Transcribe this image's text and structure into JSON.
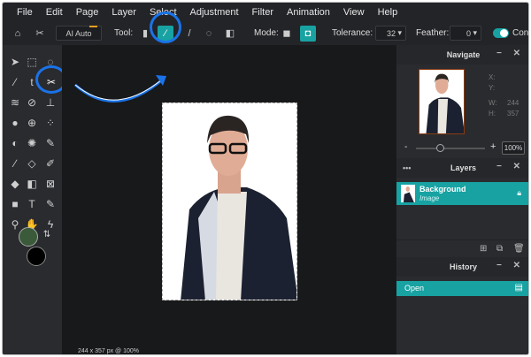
{
  "menu": [
    "File",
    "Edit",
    "Page",
    "Layer",
    "Select",
    "Adjustment",
    "Filter",
    "Animation",
    "View",
    "Help"
  ],
  "toolbar": {
    "ai_auto": "AI Auto",
    "tool_label": "Tool:",
    "mode_label": "Mode:",
    "tolerance_label": "Tolerance:",
    "tolerance_value": "32",
    "feather_label": "Feather:",
    "feather_value": "0",
    "toggle_label": "Cont",
    "toggle_on": true
  },
  "colors": {
    "accent": "#18a2a2",
    "highlight": "#1a73e8",
    "foreground": "#3a5a3a",
    "background": "#000000"
  },
  "navigate": {
    "title": "Navigate",
    "x_label": "X:",
    "y_label": "Y:",
    "w_label": "W:",
    "w_value": "244",
    "h_label": "H:",
    "h_value": "357",
    "zoom": "100%",
    "zoom_minus": "-",
    "zoom_plus": "+",
    "slider_fraction": 0.35
  },
  "layers": {
    "title": "Layers",
    "items": [
      {
        "name": "Background",
        "type": "Image"
      }
    ]
  },
  "history": {
    "title": "History",
    "items": [
      "Open"
    ]
  },
  "status": "244 x 357 px @ 100%"
}
